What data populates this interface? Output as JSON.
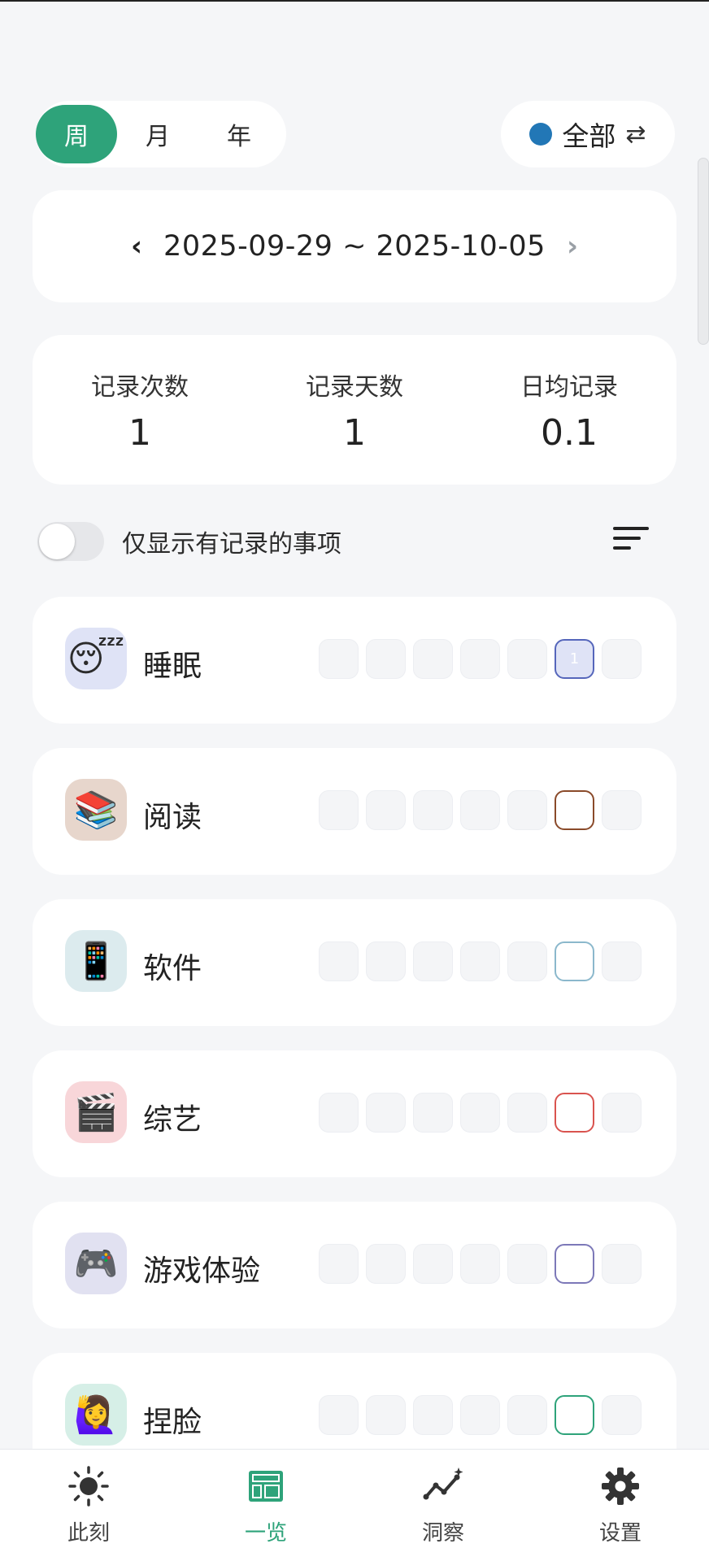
{
  "period": {
    "options": [
      "周",
      "月",
      "年"
    ],
    "selected": "周"
  },
  "filter": {
    "label": "全部",
    "dot_color": "#2277b6",
    "icon": "swap-arrows-icon"
  },
  "date_range": {
    "text": "2025-09-29 ~ 2025-10-05"
  },
  "stats": [
    {
      "label": "记录次数",
      "value": "1"
    },
    {
      "label": "记录天数",
      "value": "1"
    },
    {
      "label": "日均记录",
      "value": "0.1"
    }
  ],
  "toggle": {
    "label": "仅显示有记录的事项",
    "on": false
  },
  "items": [
    {
      "name": "睡眠",
      "emoji": "😴",
      "badge_color": "#dfe3f6",
      "accent": "#5566bb",
      "active_day": 6,
      "active_text": "1"
    },
    {
      "name": "阅读",
      "emoji": "📚",
      "badge_color": "#e7d6cc",
      "accent": "#8a4a2a",
      "active_day": 6,
      "active_text": ""
    },
    {
      "name": "软件",
      "emoji": "📱",
      "badge_color": "#dcebee",
      "accent": "#8bb8cc",
      "active_day": 6,
      "active_text": ""
    },
    {
      "name": "综艺",
      "emoji": "🎬",
      "badge_color": "#f8d6d9",
      "accent": "#d9534f",
      "active_day": 6,
      "active_text": ""
    },
    {
      "name": "游戏体验",
      "emoji": "🎮",
      "badge_color": "#e1e1f1",
      "accent": "#7c78b8",
      "active_day": 6,
      "active_text": ""
    },
    {
      "name": "捏脸",
      "emoji": "🙋‍♀️",
      "badge_color": "#d6efe7",
      "accent": "#2ea37a",
      "active_day": 6,
      "active_text": ""
    }
  ],
  "nav": [
    {
      "label": "此刻",
      "icon": "sun-icon",
      "active": false
    },
    {
      "label": "一览",
      "icon": "dashboard-icon",
      "active": true
    },
    {
      "label": "洞察",
      "icon": "insight-trend-icon",
      "active": false
    },
    {
      "label": "设置",
      "icon": "gear-icon",
      "active": false
    }
  ]
}
